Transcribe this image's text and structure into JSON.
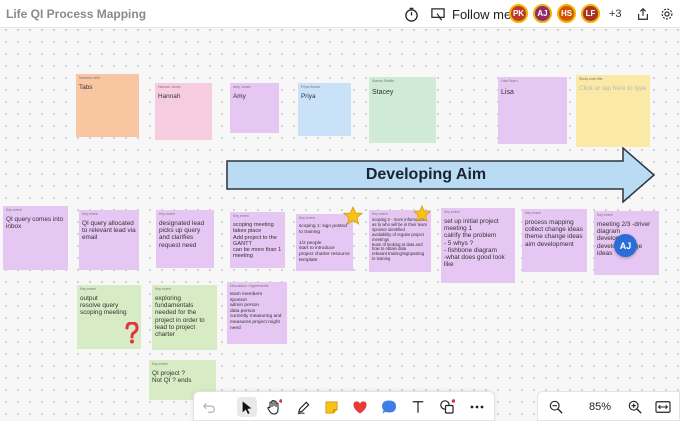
{
  "board": {
    "title": "Life QI Process Mapping"
  },
  "header": {
    "follow_label": "Follow me",
    "avatars": [
      {
        "initials": "PK",
        "color": "#c0392b"
      },
      {
        "initials": "AJ",
        "color": "#8e2c6e"
      },
      {
        "initials": "HS",
        "color": "#d35400"
      },
      {
        "initials": "LF",
        "color": "#a93226"
      }
    ],
    "more_count": "+3",
    "icons": [
      "timer-icon",
      "present-icon",
      "share-icon",
      "settings-icon"
    ]
  },
  "aim_arrow": {
    "label": "Developing Aim",
    "fill": "#b9dcf4",
    "stroke": "#2b3440"
  },
  "notes": {
    "tabs": {
      "tag": "Natasha Wild",
      "text": "Tabs",
      "color": "#f8c7a2"
    },
    "hannah": {
      "tag": "Hannah Jones",
      "text": "Hannah",
      "color": "#f6cde0"
    },
    "amy": {
      "tag": "Amy Jones",
      "text": "Amy",
      "color": "#e6c6f2"
    },
    "priya": {
      "tag": "Priya Kumar",
      "text": "Priya",
      "color": "#c9e2f7"
    },
    "stacey": {
      "tag": "Stacey Shellis",
      "text": "Stacey",
      "color": "#cfead6"
    },
    "lisa": {
      "tag": "Lisa Fearn",
      "text": "Lisa",
      "color": "#e6c6f2"
    },
    "placeholder": {
      "tag": "Sticky note title",
      "text": "Click or tap here to type",
      "color": "#fbe9a6"
    },
    "n1": {
      "tag": "Key event",
      "text": "QI query comes into inbox",
      "color": "#e6c6f2"
    },
    "n2": {
      "tag": "Key event",
      "text": "QI query allocated to relevant lead via email",
      "color": "#e6c6f2"
    },
    "n3": {
      "tag": "Key event",
      "text": "designated lead picks up query and clarifies request need",
      "color": "#e6c6f2"
    },
    "n4": {
      "tag": "Key event",
      "text": "scoping meeting takes place\nAdd project to the GANTT\ncan be more than 1 meeting",
      "color": "#e6c6f2"
    },
    "n5": {
      "tag": "Key event",
      "text": "scoping 1: sign posted to training\n\n1/2 people\nstart to introduce project charter resource template",
      "color": "#e6c6f2"
    },
    "n6": {
      "tag": "Key event",
      "text": "scoping 2 - more information as to who will be in their team sponsor identified\navailability of regular project meetings\nteam of looking at data and how to obtain data\nrelevant training/signposting to training",
      "color": "#e6c6f2"
    },
    "n7": {
      "tag": "Key event",
      "text": "set up initial project meeting 1\ncalrify the problem\n- 5 whys ?\n- fishbone diagram\n-what does good look like",
      "color": "#e6c6f2"
    },
    "n8": {
      "tag": "Key event",
      "text": "process mapping\ncollect change ideas\ntheme change ideas\naim development",
      "color": "#e6c6f2"
    },
    "n9": {
      "tag": "Key event",
      "text": "meeting 2/3 -driver diagram\ndevelop\ndevelop change ideas",
      "color": "#e6c6f2"
    },
    "g1": {
      "tag": "Key event",
      "text": "output\nresolve query\nscoping meeting",
      "color": "#d7ebc4"
    },
    "g2": {
      "tag": "Key event",
      "text": "exploring fundamentals needed for the project in order to lead to project charter",
      "color": "#d7ebc4"
    },
    "p1": {
      "tag": "Discussion / Agreements",
      "text": "team members\nsponsor\nadmin person\ndata person\ncurrently measuring and measures project might need",
      "color": "#e6c6f2"
    },
    "g3": {
      "tag": "Key event",
      "text": "QI project ?\nNot QI ? ends",
      "color": "#d7ebc4"
    }
  },
  "cursor": {
    "initials": "AJ",
    "color": "#2b6cd6"
  },
  "toolbar": {
    "tools": [
      "undo-icon",
      "select-icon",
      "hand-icon",
      "pen-icon",
      "sticky-note-icon",
      "heart-reaction-icon",
      "comment-icon",
      "text-icon",
      "shapes-icon",
      "more-icon"
    ]
  },
  "zoom": {
    "level": "85%"
  }
}
